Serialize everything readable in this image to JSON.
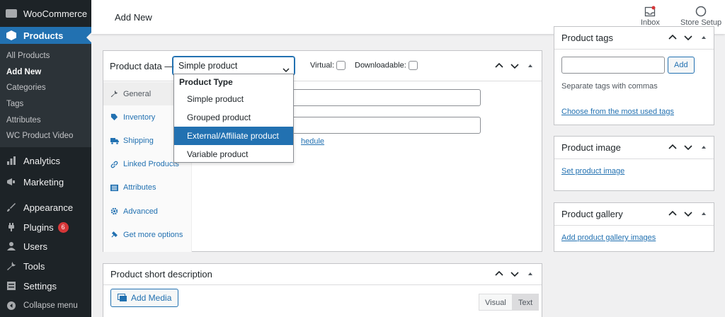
{
  "sidebar": {
    "brand": "WooCommerce",
    "current": "Products",
    "submenu": [
      "All Products",
      "Add New",
      "Categories",
      "Tags",
      "Attributes",
      "WC Product Video"
    ],
    "items": [
      "Analytics",
      "Marketing",
      "Appearance",
      "Plugins",
      "Users",
      "Tools",
      "Settings",
      "Collapse menu"
    ],
    "plugins_badge": "6"
  },
  "header": {
    "title": "Add New",
    "inbox_label": "Inbox",
    "store_setup_label": "Store Setup"
  },
  "product_data": {
    "label": "Product data —",
    "selected_type": "Simple product",
    "virtual_label": "Virtual:",
    "downloadable_label": "Downloadable:",
    "tabs": [
      "General",
      "Inventory",
      "Shipping",
      "Linked Products",
      "Attributes",
      "Advanced",
      "Get more options"
    ],
    "schedule_link_fragment": "hedule"
  },
  "dropdown": {
    "group_label": "Product Type",
    "options": [
      "Simple product",
      "Grouped product",
      "External/Affiliate product",
      "Variable product"
    ],
    "highlighted": "External/Affiliate product"
  },
  "short_description": {
    "title": "Product short description",
    "add_media": "Add Media",
    "visual_tab": "Visual",
    "text_tab": "Text"
  },
  "tags_box": {
    "title": "Product tags",
    "add_button": "Add",
    "hint": "Separate tags with commas",
    "choose_link": "Choose from the most used tags"
  },
  "image_box": {
    "title": "Product image",
    "link": "Set product image"
  },
  "gallery_box": {
    "title": "Product gallery",
    "link": "Add product gallery images"
  },
  "colors": {
    "accent": "#2271b1",
    "sidebar": "#1d2327",
    "badge": "#d63638"
  }
}
